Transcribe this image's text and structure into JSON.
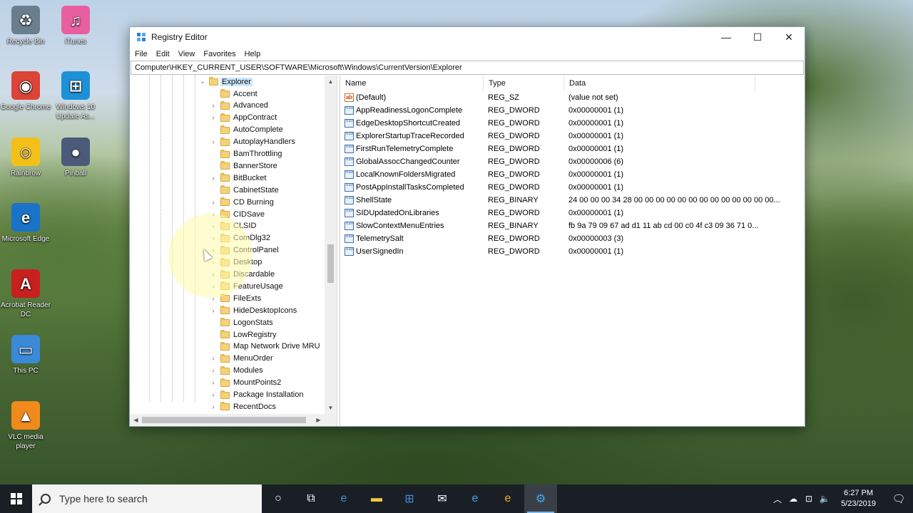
{
  "desktop": {
    "icons": [
      {
        "label": "Recycle Bin",
        "icon": "recycle-bin-icon",
        "glyph": "♻",
        "color": "#6a7f8e"
      },
      {
        "label": "iTunes",
        "icon": "itunes-icon",
        "glyph": "♫",
        "color": "#e85fa0"
      },
      {
        "label": "Google Chrome",
        "icon": "chrome-icon",
        "glyph": "◉",
        "color": "#db4437"
      },
      {
        "label": "Windows 10 Update As...",
        "icon": "windows-update-icon",
        "glyph": "⊞",
        "color": "#1e90d8"
      },
      {
        "label": "Rainbrow",
        "icon": "smiley-icon",
        "glyph": "☺",
        "color": "#f3c01a"
      },
      {
        "label": "Pinball",
        "icon": "pinball-icon",
        "glyph": "●",
        "color": "#4a5a78"
      },
      {
        "label": "Microsoft Edge",
        "icon": "edge-icon",
        "glyph": "e",
        "color": "#1a73c8"
      },
      {
        "label": "Acrobat Reader DC",
        "icon": "acrobat-icon",
        "glyph": "A",
        "color": "#c8201e"
      },
      {
        "label": "This PC",
        "icon": "this-pc-icon",
        "glyph": "▭",
        "color": "#3a8ad8"
      },
      {
        "label": "VLC media player",
        "icon": "vlc-icon",
        "glyph": "▲",
        "color": "#f08a1c"
      }
    ]
  },
  "window": {
    "title": "Registry Editor",
    "controls": {
      "minimize": "—",
      "maximize": "☐",
      "close": "✕"
    },
    "menu": [
      "File",
      "Edit",
      "View",
      "Favorites",
      "Help"
    ],
    "address": "Computer\\HKEY_CURRENT_USER\\SOFTWARE\\Microsoft\\Windows\\CurrentVersion\\Explorer"
  },
  "tree": {
    "selected": "Explorer",
    "children": [
      {
        "label": "Accent",
        "expandable": false
      },
      {
        "label": "Advanced",
        "expandable": true
      },
      {
        "label": "AppContract",
        "expandable": true
      },
      {
        "label": "AutoComplete",
        "expandable": false
      },
      {
        "label": "AutoplayHandlers",
        "expandable": true
      },
      {
        "label": "BamThrottling",
        "expandable": false
      },
      {
        "label": "BannerStore",
        "expandable": false
      },
      {
        "label": "BitBucket",
        "expandable": true
      },
      {
        "label": "CabinetState",
        "expandable": false
      },
      {
        "label": "CD Burning",
        "expandable": true
      },
      {
        "label": "CIDSave",
        "expandable": true
      },
      {
        "label": "CLSID",
        "expandable": true
      },
      {
        "label": "ComDlg32",
        "expandable": true
      },
      {
        "label": "ControlPanel",
        "expandable": true
      },
      {
        "label": "Desktop",
        "expandable": true
      },
      {
        "label": "Discardable",
        "expandable": true
      },
      {
        "label": "FeatureUsage",
        "expandable": true
      },
      {
        "label": "FileExts",
        "expandable": true
      },
      {
        "label": "HideDesktopIcons",
        "expandable": true
      },
      {
        "label": "LogonStats",
        "expandable": false
      },
      {
        "label": "LowRegistry",
        "expandable": false
      },
      {
        "label": "Map Network Drive MRU",
        "expandable": false
      },
      {
        "label": "MenuOrder",
        "expandable": true
      },
      {
        "label": "Modules",
        "expandable": true
      },
      {
        "label": "MountPoints2",
        "expandable": true
      },
      {
        "label": "Package Installation",
        "expandable": true
      },
      {
        "label": "RecentDocs",
        "expandable": true
      }
    ]
  },
  "list": {
    "columns": [
      "Name",
      "Type",
      "Data"
    ],
    "rows": [
      {
        "name": "(Default)",
        "type": "REG_SZ",
        "data": "(value not set)",
        "kind": "sz"
      },
      {
        "name": "AppReadinessLogonComplete",
        "type": "REG_DWORD",
        "data": "0x00000001 (1)",
        "kind": "bin"
      },
      {
        "name": "EdgeDesktopShortcutCreated",
        "type": "REG_DWORD",
        "data": "0x00000001 (1)",
        "kind": "bin"
      },
      {
        "name": "ExplorerStartupTraceRecorded",
        "type": "REG_DWORD",
        "data": "0x00000001 (1)",
        "kind": "bin"
      },
      {
        "name": "FirstRunTelemetryComplete",
        "type": "REG_DWORD",
        "data": "0x00000001 (1)",
        "kind": "bin"
      },
      {
        "name": "GlobalAssocChangedCounter",
        "type": "REG_DWORD",
        "data": "0x00000006 (6)",
        "kind": "bin"
      },
      {
        "name": "LocalKnownFoldersMigrated",
        "type": "REG_DWORD",
        "data": "0x00000001 (1)",
        "kind": "bin"
      },
      {
        "name": "PostAppInstallTasksCompleted",
        "type": "REG_DWORD",
        "data": "0x00000001 (1)",
        "kind": "bin"
      },
      {
        "name": "ShellState",
        "type": "REG_BINARY",
        "data": "24 00 00 00 34 28 00 00 00 00 00 00 00 00 00 00 00 00 00...",
        "kind": "bin"
      },
      {
        "name": "SIDUpdatedOnLibraries",
        "type": "REG_DWORD",
        "data": "0x00000001 (1)",
        "kind": "bin"
      },
      {
        "name": "SlowContextMenuEntries",
        "type": "REG_BINARY",
        "data": "fb 9a 79 09 67 ad d1 11 ab cd 00 c0 4f c3 09 36 71 0...",
        "kind": "bin"
      },
      {
        "name": "TelemetrySalt",
        "type": "REG_DWORD",
        "data": "0x00000003 (3)",
        "kind": "bin"
      },
      {
        "name": "UserSignedIn",
        "type": "REG_DWORD",
        "data": "0x00000001 (1)",
        "kind": "bin"
      }
    ]
  },
  "taskbar": {
    "search_placeholder": "Type here to search",
    "apps": [
      {
        "name": "cortana-icon",
        "glyph": "○"
      },
      {
        "name": "task-view-icon",
        "glyph": "⧉"
      },
      {
        "name": "edge-taskbar-icon",
        "glyph": "e",
        "color": "#3c8fe0"
      },
      {
        "name": "file-explorer-icon",
        "glyph": "▬",
        "color": "#f2c641"
      },
      {
        "name": "store-icon",
        "glyph": "⊞",
        "color": "#3c8fe0"
      },
      {
        "name": "mail-icon",
        "glyph": "✉"
      },
      {
        "name": "internet-explorer-icon",
        "glyph": "e",
        "color": "#3fa9f5"
      },
      {
        "name": "ie-alt-icon",
        "glyph": "e",
        "color": "#f2b01e"
      },
      {
        "name": "registry-editor-taskbar-icon",
        "glyph": "⚙",
        "color": "#3fa9f5",
        "active": true
      }
    ],
    "tray": {
      "time": "6:27 PM",
      "date": "5/23/2019"
    }
  }
}
